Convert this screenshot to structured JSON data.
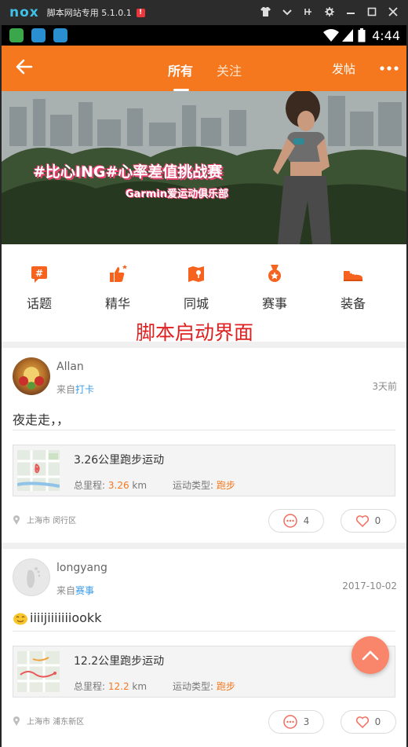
{
  "emulator": {
    "logo": "nox",
    "title": "脚本网站专用 5.1.0.1",
    "badge": "!",
    "controls": [
      "shirt-icon",
      "chevron-down-icon",
      "pin-icon",
      "gear-icon",
      "minimize-icon",
      "maximize-icon",
      "close-icon"
    ]
  },
  "status_bar": {
    "time": "4:44",
    "notification_icons": [
      "android-app-icon",
      "browser-icon",
      "browser-icon"
    ]
  },
  "header": {
    "tabs": [
      {
        "label": "所有",
        "active": true
      },
      {
        "label": "关注",
        "active": false
      }
    ],
    "post_button": "发帖",
    "accent": "#f5781e"
  },
  "banner": {
    "headline": "#比心ING#心率差值挑战赛",
    "subline": "Garmin爱运动俱乐部"
  },
  "categories": [
    {
      "label": "话题",
      "icon": "topic-icon"
    },
    {
      "label": "精华",
      "icon": "thumbs-up-star-icon"
    },
    {
      "label": "同城",
      "icon": "city-map-icon"
    },
    {
      "label": "赛事",
      "icon": "medal-icon"
    },
    {
      "label": "装备",
      "icon": "sneaker-icon"
    }
  ],
  "watermark": "脚本启动界面",
  "posts": [
    {
      "user": "Allan",
      "source_prefix": "来自",
      "source": "打卡",
      "time": "3天前",
      "text": "夜走走，，",
      "run_title": "3.26公里跑步运动",
      "distance_label": "总里程:",
      "distance_value": "3.26",
      "distance_unit": "km",
      "type_label": "运动类型:",
      "type_value": "跑步",
      "location": "上海市 闵行区",
      "comments": "4",
      "likes": "0"
    },
    {
      "user": "longyang",
      "source_prefix": "来自",
      "source": "赛事",
      "time": "2017-10-02",
      "text": "iiiijiiiiiiiookk",
      "run_title": "12.2公里跑步运动",
      "distance_label": "总里程:",
      "distance_value": "12.2",
      "distance_unit": "km",
      "type_label": "运动类型:",
      "type_value": "跑步",
      "location": "上海市 浦东新区",
      "comments": "3",
      "likes": "0"
    }
  ]
}
